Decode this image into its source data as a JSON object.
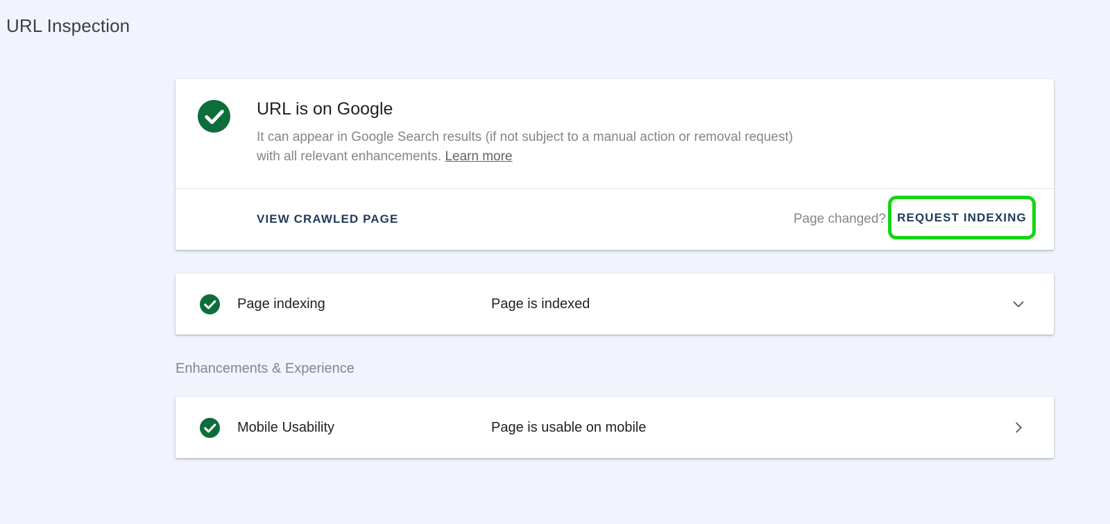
{
  "page": {
    "title": "URL Inspection"
  },
  "summary": {
    "title": "URL is on Google",
    "description": "It can appear in Google Search results (if not subject to a manual action or removal request) with all relevant enhancements.",
    "learn_more": "Learn more",
    "view_crawled_page": "VIEW CRAWLED PAGE",
    "page_changed": "Page changed?",
    "request_indexing": "REQUEST INDEXING"
  },
  "indexing": {
    "label": "Page indexing",
    "status": "Page is indexed",
    "chevron_icon": "chevron-down-icon"
  },
  "enhancements": {
    "section_label": "Enhancements & Experience",
    "items": [
      {
        "label": "Mobile Usability",
        "status": "Page is usable on mobile",
        "chevron_icon": "chevron-right-icon"
      }
    ]
  },
  "colors": {
    "background": "#f1f4fc",
    "success_green": "#0d6e3c",
    "action_text": "#1f3a5a",
    "highlight": "#14d414",
    "muted_text": "#80868b"
  }
}
